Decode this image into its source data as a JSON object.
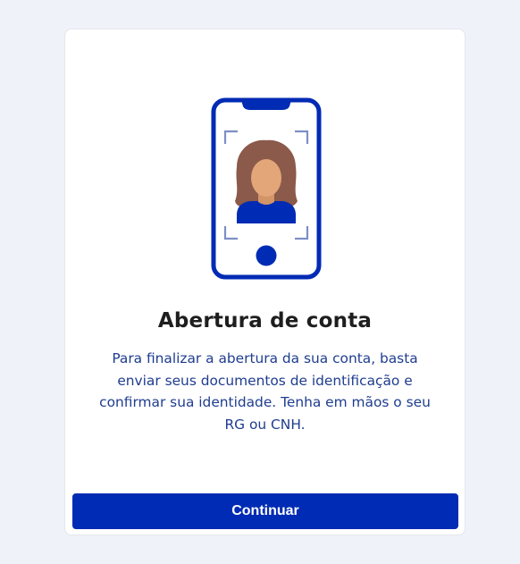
{
  "card": {
    "illustration_icon": "phone-selfie-illustration",
    "title": "Abertura de conta",
    "description": "Para finalizar a abertura da sua conta, basta enviar seus documentos de identificação e confirmar sua identidade. Tenha em mãos o seu RG ou CNH.",
    "continue_label": "Continuar"
  },
  "colors": {
    "page_background": "#eff2f9",
    "primary": "#002bb4",
    "description_text": "#1f3d8f",
    "title_text": "#1e1e1e",
    "hair": "#8b5a4a",
    "skin": "#e3a679"
  }
}
